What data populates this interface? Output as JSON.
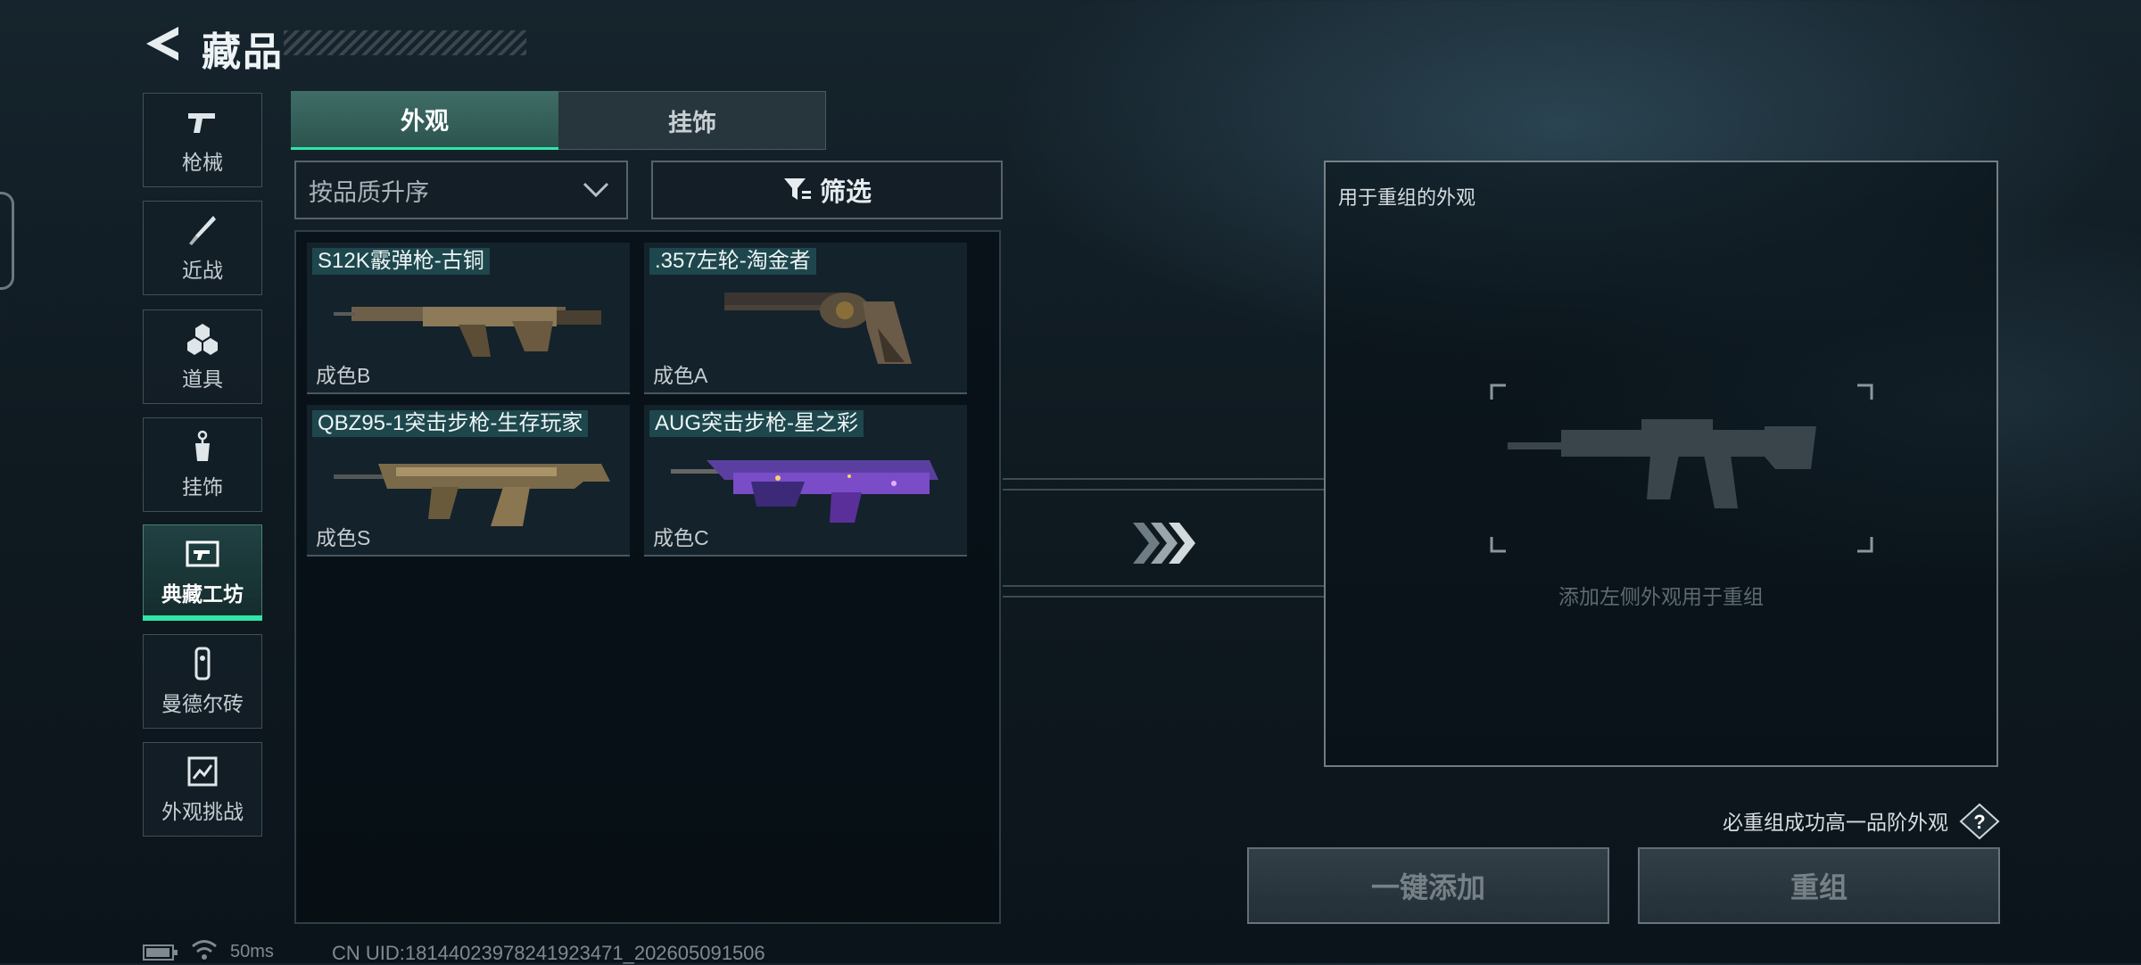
{
  "header": {
    "title": "藏品"
  },
  "sidebar": {
    "items": [
      {
        "label": "枪械",
        "icon": "pistol-icon"
      },
      {
        "label": "近战",
        "icon": "knife-icon"
      },
      {
        "label": "道具",
        "icon": "items-icon"
      },
      {
        "label": "挂饰",
        "icon": "charm-icon"
      },
      {
        "label": "典藏工坊",
        "icon": "workshop-icon",
        "active": true
      },
      {
        "label": "曼德尔砖",
        "icon": "brick-icon"
      },
      {
        "label": "外观挑战",
        "icon": "challenge-icon"
      }
    ]
  },
  "tabs": [
    {
      "label": "外观",
      "active": true
    },
    {
      "label": "挂饰",
      "active": false
    }
  ],
  "sort": {
    "selected": "按品质升序"
  },
  "filter": {
    "label": "筛选"
  },
  "skins": [
    {
      "name": "S12K霰弹枪-古铜",
      "quality": "成色B"
    },
    {
      "name": ".357左轮-淘金者",
      "quality": "成色A"
    },
    {
      "name": "QBZ95-1突击步枪-生存玩家",
      "quality": "成色S"
    },
    {
      "name": "AUG突击步枪-星之彩",
      "quality": "成色C"
    }
  ],
  "reorg_panel": {
    "title": "用于重组的外观",
    "hint": "添加左侧外观用于重组"
  },
  "guarantee_text": "必重组成功高一品阶外观",
  "buttons": {
    "quick_add": "一键添加",
    "recombine": "重组"
  },
  "status": {
    "ping": "50ms",
    "uid": "CN UID:18144023978241923471_202605091506"
  },
  "colors": {
    "accent": "#2ee6a8",
    "tab_active": "#3f6d66"
  }
}
